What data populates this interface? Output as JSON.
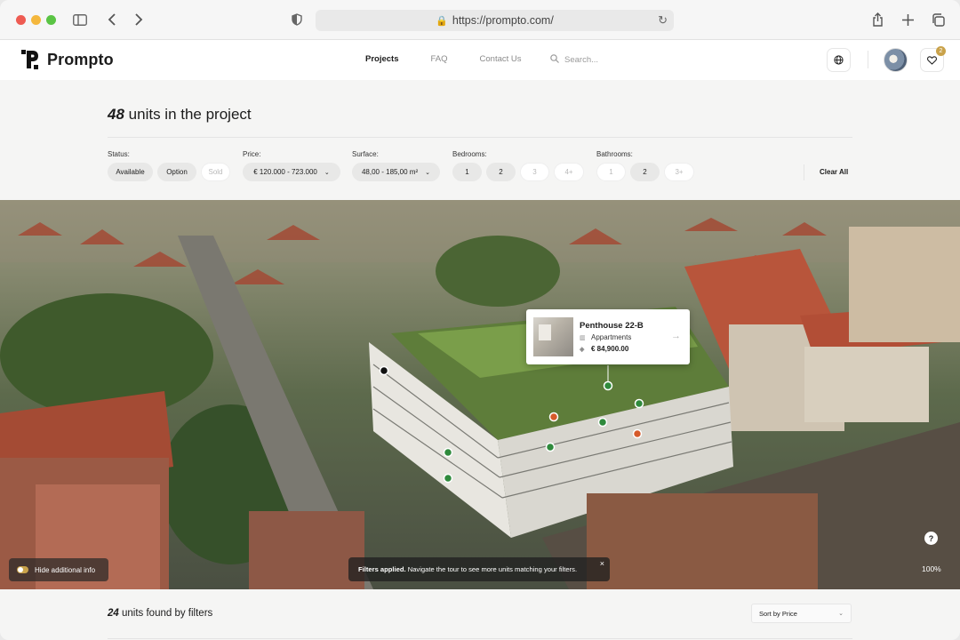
{
  "browser": {
    "url": "https://prompto.com/"
  },
  "header": {
    "brand": "Prompto",
    "nav": [
      "Projects",
      "FAQ",
      "Contact Us"
    ],
    "search_placeholder": "Search...",
    "favorites_count": "2"
  },
  "summary": {
    "count": "48",
    "text": "units in the project"
  },
  "filters": {
    "status_label": "Status:",
    "status": [
      {
        "label": "Available",
        "active": true
      },
      {
        "label": "Option",
        "active": true
      },
      {
        "label": "Sold",
        "active": false
      }
    ],
    "price_label": "Price:",
    "price_value": "€ 120.000 - 723.000",
    "surface_label": "Surface:",
    "surface_value": "48,00 - 185,00 m²",
    "bedrooms_label": "Bedrooms:",
    "bedrooms": [
      {
        "label": "1",
        "active": true
      },
      {
        "label": "2",
        "active": true
      },
      {
        "label": "3",
        "active": false
      },
      {
        "label": "4+",
        "active": false
      }
    ],
    "bathrooms_label": "Bathrooms:",
    "bathrooms": [
      {
        "label": "1",
        "active": false
      },
      {
        "label": "2",
        "active": true
      },
      {
        "label": "3+",
        "active": false
      }
    ],
    "clear_all": "Clear All"
  },
  "popup": {
    "title": "Penthouse 22-B",
    "type": "Appartments",
    "price": "€ 84,900.00"
  },
  "overlay": {
    "hide_info": "Hide additional info",
    "notice_bold": "Filters applied.",
    "notice_text": "Navigate the tour to see more units matching your filters.",
    "close": "×",
    "help": "?",
    "zoom": "100%"
  },
  "results": {
    "count": "24",
    "text": "units found by filters",
    "sort_label": "Sort by Price"
  },
  "colors": {
    "accent_gold": "#c9a24a",
    "marker_green": "#2f8a3c",
    "marker_orange": "#d65a2a"
  }
}
